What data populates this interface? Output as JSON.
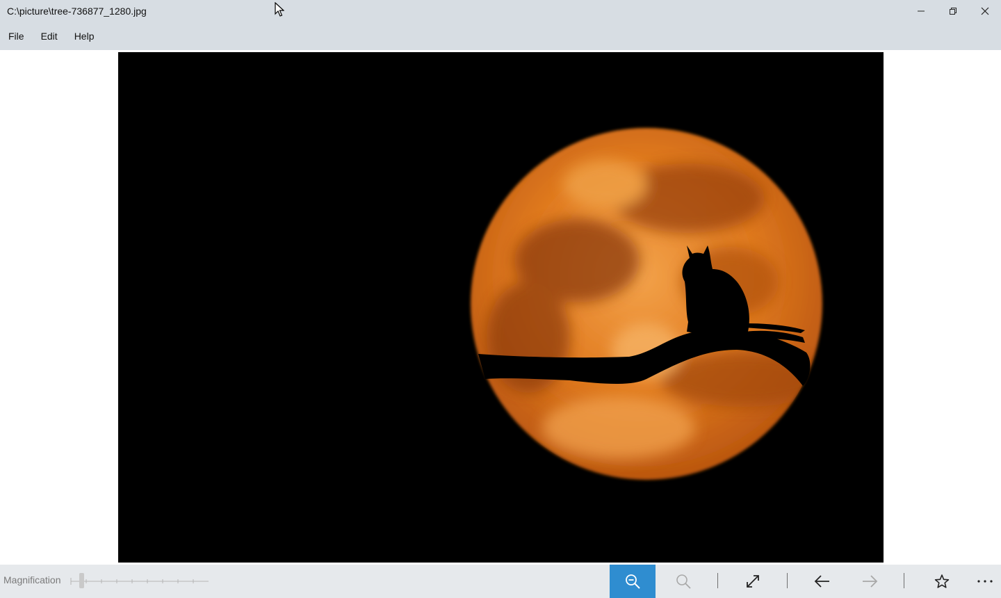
{
  "window": {
    "title": "C:\\picture\\tree-736877_1280.jpg",
    "controls": [
      "minimize-icon",
      "restore-icon",
      "close-icon"
    ]
  },
  "menu": {
    "items": [
      {
        "label": "File"
      },
      {
        "label": "Edit"
      },
      {
        "label": "Help"
      }
    ]
  },
  "toolbar": {
    "magnification_label": "Magnification",
    "buttons": [
      {
        "icon": "zoom-out-icon",
        "active": true
      },
      {
        "icon": "zoom-in-icon",
        "active": false,
        "disabled": true
      },
      {
        "icon": "fit-to-window-icon"
      },
      {
        "icon": "arrow-left-icon"
      },
      {
        "icon": "arrow-right-icon",
        "disabled": true
      },
      {
        "icon": "star-icon"
      },
      {
        "icon": "more-icon"
      }
    ]
  },
  "colors": {
    "header_bg": "#d7dde3",
    "toolbar_bg": "#e6e9ec",
    "accent": "#2f8dd0",
    "moon": "#e07a1f"
  }
}
